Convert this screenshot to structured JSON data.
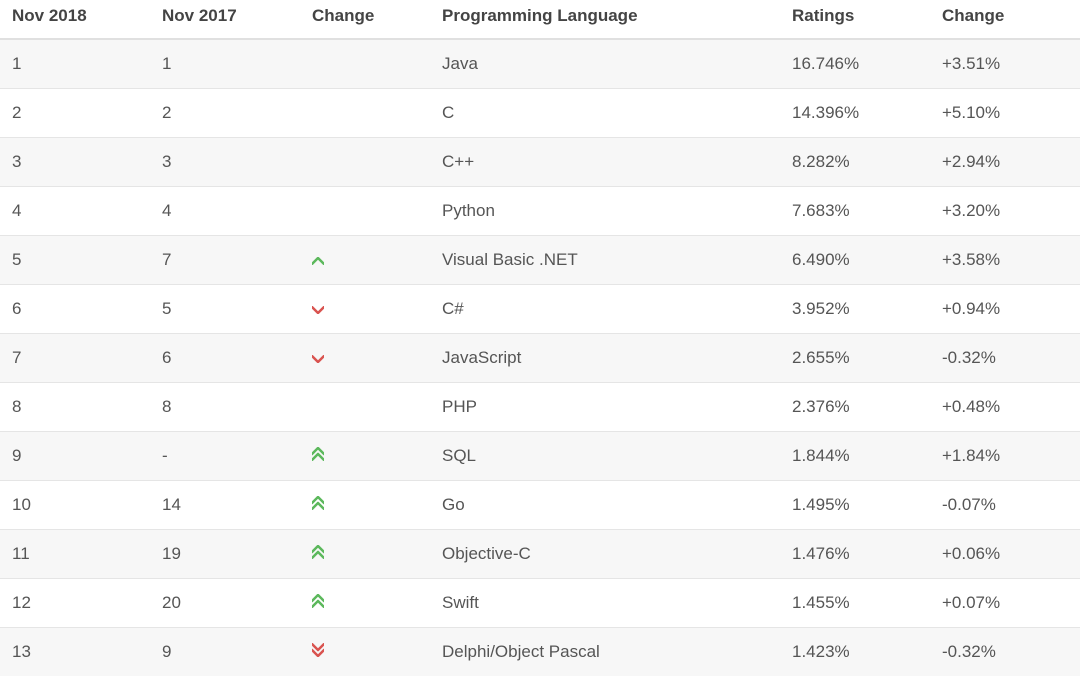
{
  "headers": {
    "nov2018": "Nov 2018",
    "nov2017": "Nov 2017",
    "change1": "Change",
    "language": "Programming Language",
    "ratings": "Ratings",
    "change2": "Change"
  },
  "rows": [
    {
      "nov2018": "1",
      "nov2017": "1",
      "trend": "none",
      "language": "Java",
      "ratings": "16.746%",
      "change": "+3.51%"
    },
    {
      "nov2018": "2",
      "nov2017": "2",
      "trend": "none",
      "language": "C",
      "ratings": "14.396%",
      "change": "+5.10%"
    },
    {
      "nov2018": "3",
      "nov2017": "3",
      "trend": "none",
      "language": "C++",
      "ratings": "8.282%",
      "change": "+2.94%"
    },
    {
      "nov2018": "4",
      "nov2017": "4",
      "trend": "none",
      "language": "Python",
      "ratings": "7.683%",
      "change": "+3.20%"
    },
    {
      "nov2018": "5",
      "nov2017": "7",
      "trend": "up",
      "language": "Visual Basic .NET",
      "ratings": "6.490%",
      "change": "+3.58%"
    },
    {
      "nov2018": "6",
      "nov2017": "5",
      "trend": "down",
      "language": "C#",
      "ratings": "3.952%",
      "change": "+0.94%"
    },
    {
      "nov2018": "7",
      "nov2017": "6",
      "trend": "down",
      "language": "JavaScript",
      "ratings": "2.655%",
      "change": "-0.32%"
    },
    {
      "nov2018": "8",
      "nov2017": "8",
      "trend": "none",
      "language": "PHP",
      "ratings": "2.376%",
      "change": "+0.48%"
    },
    {
      "nov2018": "9",
      "nov2017": "-",
      "trend": "double-up",
      "language": "SQL",
      "ratings": "1.844%",
      "change": "+1.84%"
    },
    {
      "nov2018": "10",
      "nov2017": "14",
      "trend": "double-up",
      "language": "Go",
      "ratings": "1.495%",
      "change": "-0.07%"
    },
    {
      "nov2018": "11",
      "nov2017": "19",
      "trend": "double-up",
      "language": "Objective-C",
      "ratings": "1.476%",
      "change": "+0.06%"
    },
    {
      "nov2018": "12",
      "nov2017": "20",
      "trend": "double-up",
      "language": "Swift",
      "ratings": "1.455%",
      "change": "+0.07%"
    },
    {
      "nov2018": "13",
      "nov2017": "9",
      "trend": "double-down",
      "language": "Delphi/Object Pascal",
      "ratings": "1.423%",
      "change": "-0.32%"
    }
  ],
  "chart_data": {
    "type": "table",
    "title": "TIOBE Index Rankings",
    "columns": [
      "Nov 2018",
      "Nov 2017",
      "Change",
      "Programming Language",
      "Ratings",
      "Change"
    ],
    "data": [
      [
        1,
        1,
        "",
        "Java",
        16.746,
        3.51
      ],
      [
        2,
        2,
        "",
        "C",
        14.396,
        5.1
      ],
      [
        3,
        3,
        "",
        "C++",
        8.282,
        2.94
      ],
      [
        4,
        4,
        "",
        "Python",
        7.683,
        3.2
      ],
      [
        5,
        7,
        "up",
        "Visual Basic .NET",
        6.49,
        3.58
      ],
      [
        6,
        5,
        "down",
        "C#",
        3.952,
        0.94
      ],
      [
        7,
        6,
        "down",
        "JavaScript",
        2.655,
        -0.32
      ],
      [
        8,
        8,
        "",
        "PHP",
        2.376,
        0.48
      ],
      [
        9,
        null,
        "double-up",
        "SQL",
        1.844,
        1.84
      ],
      [
        10,
        14,
        "double-up",
        "Go",
        1.495,
        -0.07
      ],
      [
        11,
        19,
        "double-up",
        "Objective-C",
        1.476,
        0.06
      ],
      [
        12,
        20,
        "double-up",
        "Swift",
        1.455,
        0.07
      ],
      [
        13,
        9,
        "double-down",
        "Delphi/Object Pascal",
        1.423,
        -0.32
      ]
    ]
  }
}
